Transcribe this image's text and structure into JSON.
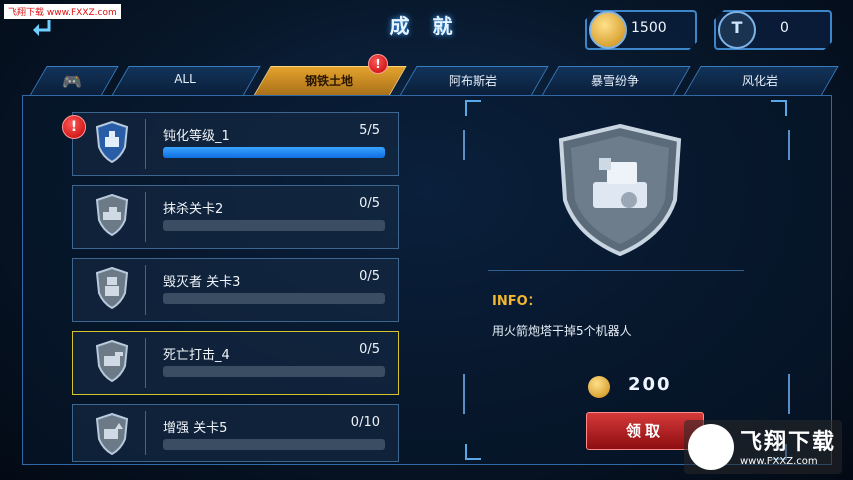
{
  "watermark_top": "飞翔下载 www.FXXZ.com",
  "header": {
    "back_icon": "back-arrow-icon",
    "title": "成 就"
  },
  "currencies": [
    {
      "icon": "coin-chest-icon",
      "value": "1500"
    },
    {
      "icon": "token-t-icon",
      "value": "0"
    }
  ],
  "tabs": [
    {
      "label": "",
      "icon": "gamepad-icon"
    },
    {
      "label": "ALL"
    },
    {
      "label": "钢铁土地",
      "active": true,
      "alert": "!"
    },
    {
      "label": "阿布斯岩"
    },
    {
      "label": "暴雪纷争"
    },
    {
      "label": "风化岩"
    }
  ],
  "achievements": [
    {
      "name": "钝化等级_1",
      "progress": "5/5",
      "fraction": 1.0,
      "alert": "!",
      "icon": "turret-shield-icon"
    },
    {
      "name": "抹杀关卡2",
      "progress": "0/5",
      "fraction": 0,
      "icon": "tank-shield-icon"
    },
    {
      "name": "毁灭者 关卡3",
      "progress": "0/5",
      "fraction": 0,
      "icon": "robot-shield-icon"
    },
    {
      "name": "死亡打击_4",
      "progress": "0/5",
      "fraction": 0,
      "icon": "cannon-shield-icon",
      "selected": true
    },
    {
      "name": "增强 关卡5",
      "progress": "0/10",
      "fraction": 0,
      "icon": "upgrade-shield-icon"
    }
  ],
  "detail": {
    "icon": "rocket-turret-shield-icon",
    "info_label": "INFO：",
    "info_text": "用火箭炮塔干掉5个机器人",
    "reward_icon": "coin-icon",
    "reward_value": "200",
    "claim_label": "领取"
  },
  "watermark_logo": {
    "title": "飞翔下载",
    "url": "www.FXXZ.com"
  },
  "colors": {
    "accent": "#3aa4ff",
    "active_tab": "#e4a32c",
    "alert": "#d10000",
    "info": "#f2b632"
  }
}
